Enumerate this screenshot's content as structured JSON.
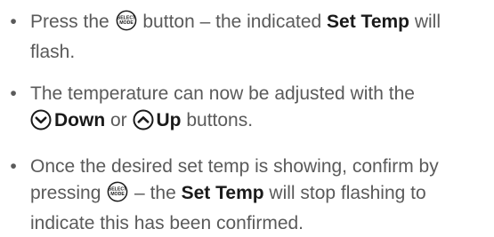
{
  "instructions": [
    {
      "lines": [
        [
          {
            "t": "text",
            "v": "Press the "
          },
          {
            "t": "icon",
            "name": "select-mode-button-icon",
            "labels": [
              "SELECT",
              "MODE"
            ]
          },
          {
            "t": "text",
            "v": " button – the indicated "
          },
          {
            "t": "bold",
            "v": "Set Temp"
          },
          {
            "t": "text",
            "v": " will"
          }
        ],
        [
          {
            "t": "text",
            "v": "flash."
          }
        ]
      ]
    },
    {
      "lines": [
        [
          {
            "t": "text",
            "v": "The temperature can now be adjusted with the"
          }
        ],
        [
          {
            "t": "icon",
            "name": "down-arrow-button-icon"
          },
          {
            "t": "bold",
            "v": "Down"
          },
          {
            "t": "text",
            "v": " or "
          },
          {
            "t": "icon",
            "name": "up-arrow-button-icon"
          },
          {
            "t": "bold",
            "v": "Up"
          },
          {
            "t": "text",
            "v": " buttons."
          }
        ]
      ]
    },
    {
      "lines": [
        [
          {
            "t": "text",
            "v": "Once the desired set temp is showing, confirm by"
          }
        ],
        [
          {
            "t": "text",
            "v": "pressing "
          },
          {
            "t": "icon",
            "name": "select-mode-button-icon",
            "labels": [
              "SELECT",
              "MODE"
            ]
          },
          {
            "t": "text",
            "v": " – the "
          },
          {
            "t": "bold",
            "v": "Set Temp"
          },
          {
            "t": "text",
            "v": " will stop flashing to"
          }
        ],
        [
          {
            "t": "text",
            "v": "indicate this has been confirmed."
          }
        ]
      ]
    }
  ],
  "bullet_char": "•",
  "colors": {
    "body_text": "#5a5a5a",
    "bold_text": "#1a1a1a",
    "icon_stroke": "#1a1a1a"
  }
}
